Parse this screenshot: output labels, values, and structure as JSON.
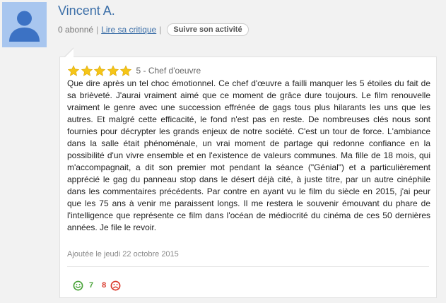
{
  "user": {
    "name": "Vincent A.",
    "followers": "0 abonné",
    "separator": "|",
    "read_review_link": "Lire sa critique",
    "follow_button": "Suivre son activité"
  },
  "review": {
    "rating": 5,
    "max_rating": 5,
    "rating_label": "5 - Chef d'oeuvre",
    "star_color": "#f5c518",
    "text": "Que dire après un tel choc émotionnel. Ce chef d'œuvre a failli manquer les 5 étoiles du fait de sa brièveté. J'aurai vraiment aimé que ce moment de grâce dure toujours. Le film renouvelle vraiment le genre avec une succession effrénée de gags tous plus hilarants les uns que les autres. Et malgré cette efficacité, le fond n'est pas en reste. De nombreuses clés nous sont fournies pour décrypter les grands enjeux de notre société. C'est un tour de force. L'ambiance dans la salle était phénoménale, un vrai moment de partage qui redonne confiance en la possibilité d'un vivre ensemble et en l'existence de valeurs communes. Ma fille de 18 mois, qui m'accompagnait, a dit son premier mot pendant la séance (\"Génial\") et a particulièrement apprécié le gag du panneau stop dans le désert déjà cité, à juste titre, par un autre cinéphile dans les commentaires précédents. Par contre en ayant vu le film du siècle en 2015, j'ai peur que les 75 ans à venir me paraissent longs. Il me restera le souvenir émouvant du phare de l'intelligence que représente ce film dans l'océan de médiocrité du cinéma de ces 50 dernières années. Je file le revoir.",
    "date": "Ajoutée le jeudi 22 octobre 2015"
  },
  "votes": {
    "up_icon": "smiley-happy-icon",
    "up_count": "7",
    "up_color": "#4aa33a",
    "down_icon": "smiley-sad-icon",
    "down_count": "8",
    "down_color": "#d9382a"
  }
}
